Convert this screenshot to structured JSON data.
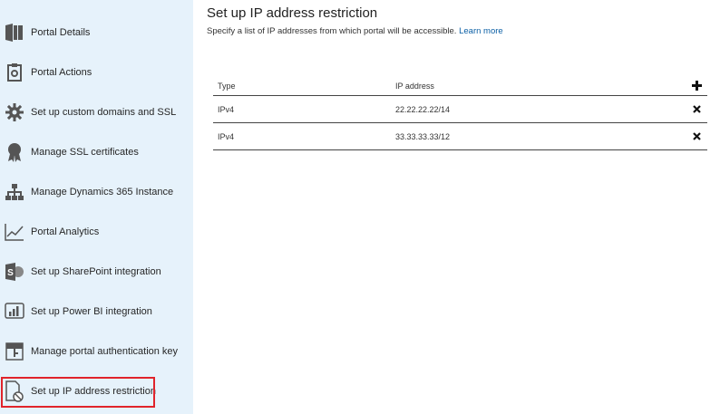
{
  "sidebar": {
    "items": [
      {
        "label": "Portal Details",
        "icon": "portal-details-icon"
      },
      {
        "label": "Portal Actions",
        "icon": "portal-actions-icon"
      },
      {
        "label": "Set up custom domains and SSL",
        "icon": "gear-icon"
      },
      {
        "label": "Manage SSL certificates",
        "icon": "certificate-ribbon-icon"
      },
      {
        "label": "Manage Dynamics 365 Instance",
        "icon": "org-hierarchy-icon"
      },
      {
        "label": "Portal Analytics",
        "icon": "line-chart-icon"
      },
      {
        "label": "Set up SharePoint integration",
        "icon": "sharepoint-icon"
      },
      {
        "label": "Set up Power BI integration",
        "icon": "powerbi-icon"
      },
      {
        "label": "Manage portal authentication key",
        "icon": "auth-key-icon"
      },
      {
        "label": "Set up IP address restriction",
        "icon": "ip-restriction-icon",
        "selected": true
      }
    ]
  },
  "main": {
    "title": "Set up IP address restriction",
    "description": "Specify a list of IP addresses from which portal will be accessible.",
    "learn_more": "Learn more",
    "table": {
      "headers": {
        "type": "Type",
        "ip": "IP address"
      },
      "rows": [
        {
          "type": "IPv4",
          "ip": "22.22.22.22/14"
        },
        {
          "type": "IPv4",
          "ip": "33.33.33.33/12"
        }
      ]
    }
  },
  "colors": {
    "sidebar_bg": "#e6f2fb",
    "link": "#0b5fa5",
    "selected_outline": "#e0242b"
  }
}
